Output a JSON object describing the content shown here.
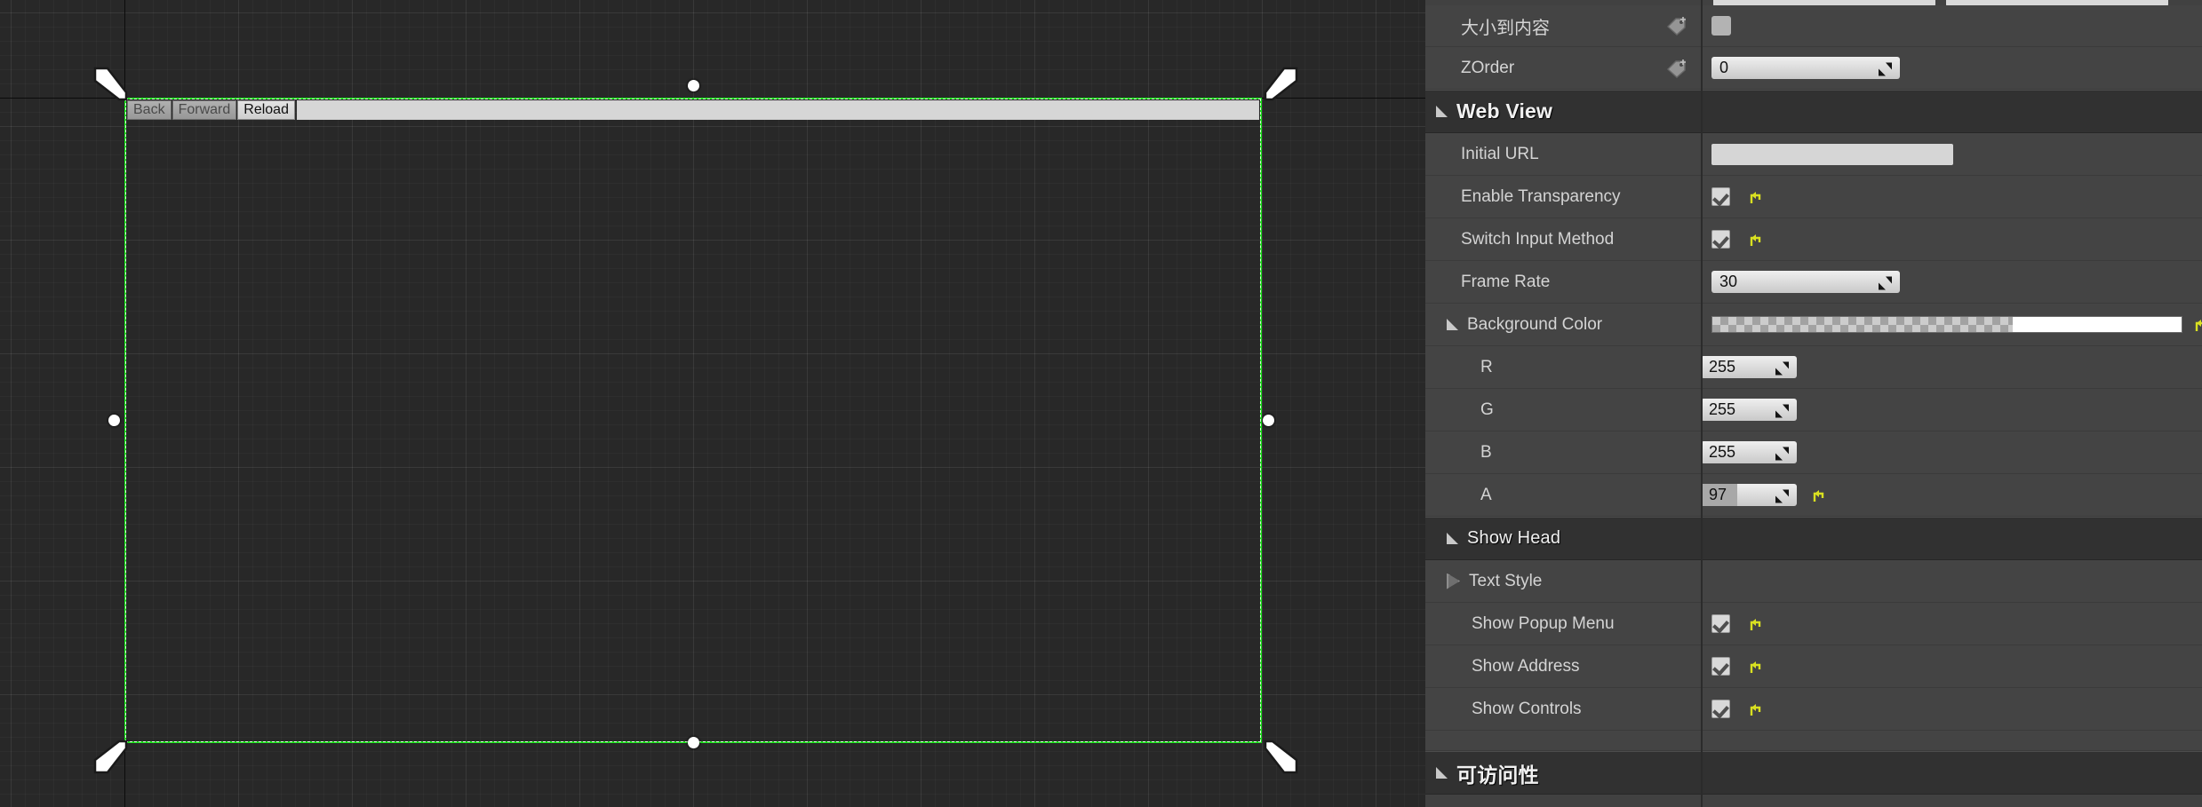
{
  "viewport": {
    "name": "umg-designer-canvas",
    "grid_color": "#282828",
    "selection_color": "#1ae01a",
    "widget": {
      "name": "web-view-widget",
      "browser_head": {
        "back_label": "Back",
        "forward_label": "Forward",
        "reload_label": "Reload",
        "address_value": "",
        "address_placeholder": ""
      }
    }
  },
  "details": {
    "rows_top": [
      {
        "label": "大小到内容",
        "type": "checkbox-empty",
        "bindable": true
      },
      {
        "label": "ZOrder",
        "type": "number",
        "value": "0",
        "bindable": true
      }
    ],
    "categories": {
      "web_view": "Web View",
      "show_head": "Show Head",
      "accessibility": "可访问性"
    },
    "web_view_rows": [
      {
        "label": "Initial URL",
        "type": "text",
        "value": ""
      },
      {
        "label": "Enable Transparency",
        "type": "checkbox",
        "checked": true,
        "reset": true
      },
      {
        "label": "Switch Input Method",
        "type": "checkbox",
        "checked": true,
        "reset": true
      },
      {
        "label": "Frame Rate",
        "type": "number",
        "value": "30"
      }
    ],
    "background_color": {
      "label": "Background Color",
      "swatch_alpha_pattern": "checker",
      "swatch_solid": "#ffffff",
      "reset": true,
      "channels": [
        {
          "label": "R",
          "value": "255",
          "fill_pct": 100
        },
        {
          "label": "G",
          "value": "255",
          "fill_pct": 100
        },
        {
          "label": "B",
          "value": "255",
          "fill_pct": 100
        },
        {
          "label": "A",
          "value": "97",
          "fill_pct": 38,
          "reset": true
        }
      ]
    },
    "show_head_rows": [
      {
        "label": "Text Style",
        "type": "expander"
      },
      {
        "label": "Show Popup Menu",
        "type": "checkbox",
        "checked": true,
        "reset": true
      },
      {
        "label": "Show Address",
        "type": "checkbox",
        "checked": true,
        "reset": true
      },
      {
        "label": "Show Controls",
        "type": "checkbox",
        "checked": true,
        "reset": true
      }
    ]
  },
  "colors": {
    "panel_bg": "#414141",
    "category_bg": "#313131",
    "accent_green": "#1ae01a",
    "reset_yellow": "#d9e021",
    "label_text": "#d4d4d4"
  }
}
